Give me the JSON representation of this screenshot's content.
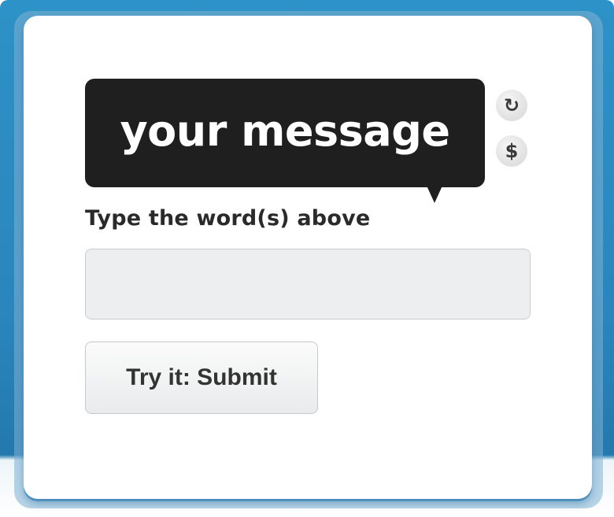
{
  "captcha": {
    "challenge_text": "your message",
    "refresh_icon": "↻",
    "refresh_icon_name": "refresh-icon",
    "audio_icon": "$",
    "audio_icon_name": "dollar-icon"
  },
  "form": {
    "prompt": "Type the word(s) above",
    "answer_value": "",
    "answer_placeholder": "",
    "submit_label": "Try it: Submit"
  },
  "colors": {
    "frame_blue": "#2a86bd",
    "bubble_bg": "#1f1f1f",
    "card_bg": "#ffffff"
  }
}
